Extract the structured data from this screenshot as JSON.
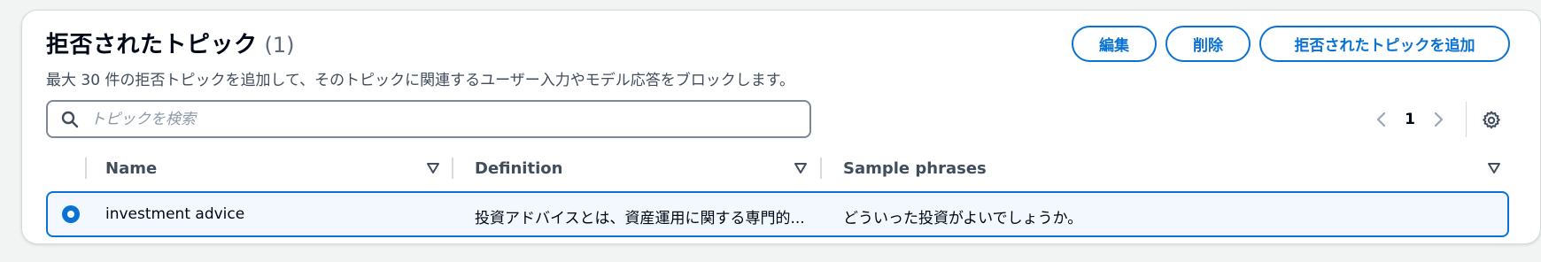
{
  "header": {
    "title": "拒否されたトピック",
    "count": "(1)",
    "description": "最大 30 件の拒否トピックを追加して、そのトピックに関連するユーザー入力やモデル応答をブロックします。"
  },
  "actions": {
    "edit_label": "編集",
    "delete_label": "削除",
    "add_label": "拒否されたトピックを追加"
  },
  "search": {
    "placeholder": "トピックを検索",
    "value": ""
  },
  "pagination": {
    "current_page": "1"
  },
  "table": {
    "columns": [
      "Name",
      "Definition",
      "Sample phrases"
    ],
    "rows": [
      {
        "selected": true,
        "name": "investment advice",
        "definition": "投資アドバイスとは、資産運用に関する専門的...",
        "sample_phrases": "どういった投資がよいでしょうか。"
      }
    ]
  },
  "colors": {
    "accent": "#0972d3",
    "selected_row_bg": "#f2f8fd",
    "text_primary": "#000716",
    "text_secondary": "#414d5c"
  },
  "icons": {
    "search": "search-icon",
    "prev": "chevron-left-icon",
    "next": "chevron-right-icon",
    "settings": "gear-icon",
    "sort": "sort-triangle-down-icon"
  }
}
